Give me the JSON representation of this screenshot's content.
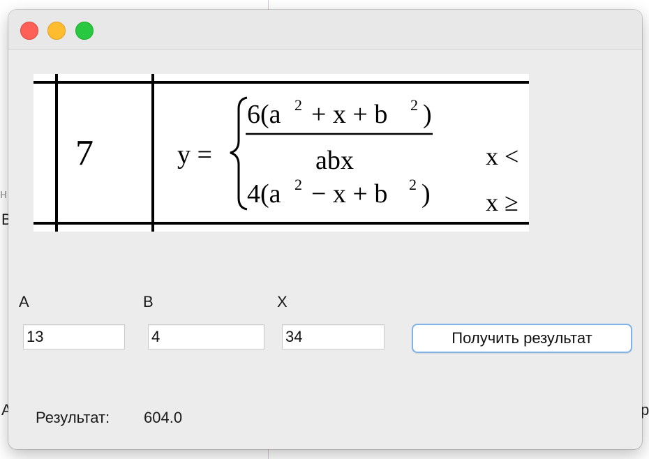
{
  "background": {
    "fragments": [
      "н",
      "В",
      "А",
      "р"
    ]
  },
  "window": {
    "traffic_lights": {
      "close_color": "#fe5f57",
      "minimize_color": "#febc2e",
      "maximize_color": "#28c840"
    }
  },
  "formula_image": {
    "row_number": "7",
    "y_lhs": "y =",
    "top_numerator": "6(a",
    "top_sup1": "2",
    "top_mid": "+ x + b",
    "top_sup2": "2",
    "top_close": ")",
    "denominator": "abx",
    "bottom_expr": "4(a",
    "bottom_sup1": "2",
    "bottom_mid": "− x + b",
    "bottom_sup2": "2",
    "bottom_close": ")",
    "cond_top": "x <",
    "cond_bottom": "x ≥"
  },
  "inputs": {
    "a": {
      "label": "A",
      "value": "13"
    },
    "b": {
      "label": "B",
      "value": "4"
    },
    "x": {
      "label": "X",
      "value": "34"
    }
  },
  "compute_button_label": "Получить результат",
  "result": {
    "label": "Результат:",
    "value": "604.0"
  },
  "colors": {
    "accent_focus": "#7fb2e8",
    "window_bg": "#ececec"
  }
}
